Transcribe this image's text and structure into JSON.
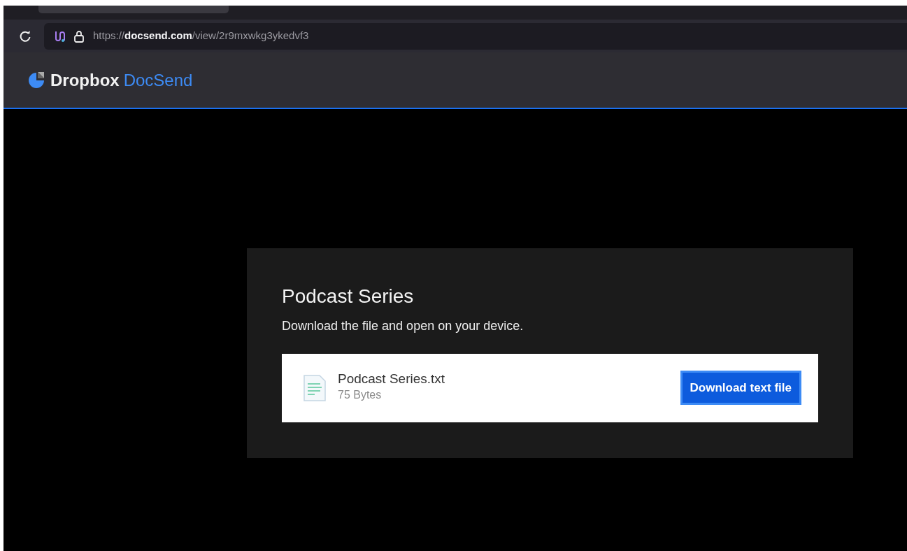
{
  "browser": {
    "url": "https://**docsend.com**/view/2r9mxwkg3ykedvf3"
  },
  "header": {
    "brand": "Dropbox",
    "product": "DocSend"
  },
  "card": {
    "title": "Podcast Series",
    "subtitle": "Download the file and open on your device.",
    "file": {
      "name": "Podcast Series.txt",
      "size": "75 Bytes"
    },
    "button": "Download text file"
  }
}
